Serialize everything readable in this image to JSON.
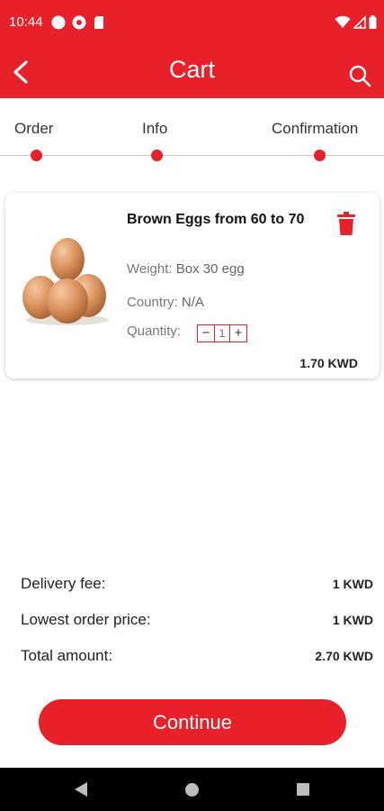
{
  "status_bar": {
    "time": "10:44"
  },
  "app_bar": {
    "title": "Cart"
  },
  "stepper": {
    "steps": [
      {
        "label": "Order"
      },
      {
        "label": "Info"
      },
      {
        "label": "Confirmation"
      }
    ]
  },
  "cart": {
    "items": [
      {
        "name": "Brown Eggs from 60 to 70",
        "weight_label": "Weight:",
        "weight": "Box 30 egg",
        "country_label": "Country:",
        "country": "N/A",
        "quantity_label": "Quantity:",
        "quantity": "1",
        "price": "1.70 KWD"
      }
    ]
  },
  "summary": {
    "delivery_fee_label": "Delivery fee:",
    "delivery_fee": "1 KWD",
    "lowest_order_label": "Lowest order price:",
    "lowest_order": "1 KWD",
    "total_label": "Total amount:",
    "total": "2.70 KWD"
  },
  "continue_label": "Continue",
  "colors": {
    "accent": "#e8202a"
  }
}
